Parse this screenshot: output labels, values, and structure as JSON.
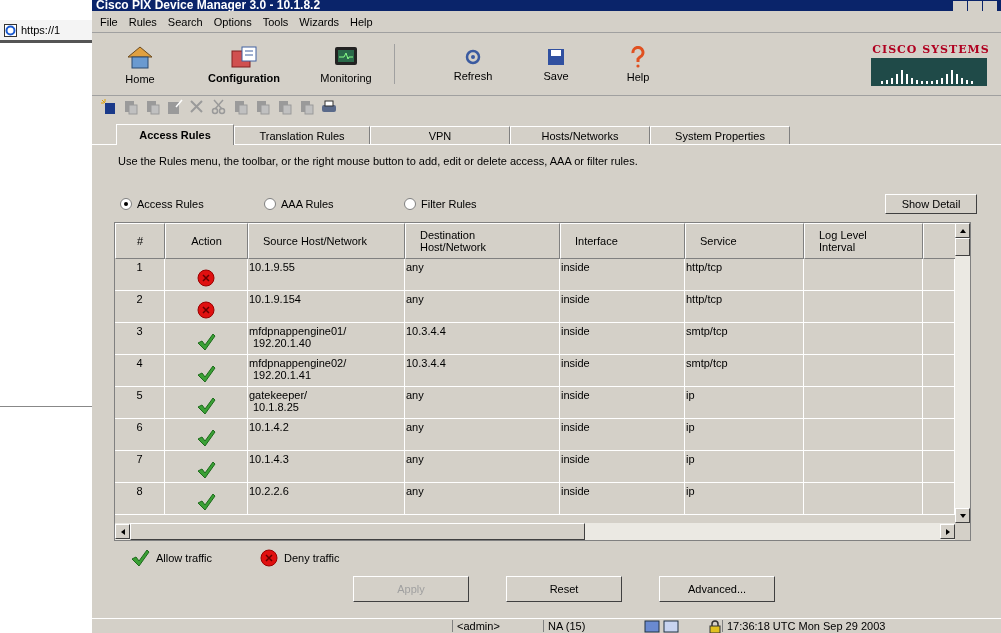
{
  "browser": {
    "address": "https://1"
  },
  "window": {
    "title": "Cisco PIX Device Manager 3.0 - 10.1.8.2"
  },
  "menu": [
    "File",
    "Rules",
    "Search",
    "Options",
    "Tools",
    "Wizards",
    "Help"
  ],
  "toolbar": [
    {
      "label": "Home",
      "kind": "house",
      "selected": false
    },
    {
      "label": "Configuration",
      "kind": "firewall",
      "selected": true
    },
    {
      "label": "Monitoring",
      "kind": "monitor",
      "selected": false
    },
    {
      "label": "Refresh",
      "kind": "refresh",
      "selected": false
    },
    {
      "label": "Save",
      "kind": "disk",
      "selected": false
    },
    {
      "label": "Help",
      "kind": "question",
      "selected": false
    }
  ],
  "logo": {
    "text": "CISCO SYSTEMS"
  },
  "rule_toolbar": [
    {
      "kind": "new",
      "disabled": false
    },
    {
      "kind": "insert",
      "disabled": true
    },
    {
      "kind": "insert-after",
      "disabled": true
    },
    {
      "kind": "edit",
      "disabled": true
    },
    {
      "kind": "delete",
      "disabled": true
    },
    {
      "kind": "cut",
      "disabled": true
    },
    {
      "kind": "copy",
      "disabled": true
    },
    {
      "kind": "paste",
      "disabled": true
    },
    {
      "kind": "paste-after",
      "disabled": true
    },
    {
      "kind": "paste-before",
      "disabled": true
    },
    {
      "kind": "print",
      "disabled": false
    }
  ],
  "tabs": [
    {
      "label": "Access Rules",
      "selected": true
    },
    {
      "label": "Translation Rules",
      "selected": false
    },
    {
      "label": "VPN",
      "selected": false
    },
    {
      "label": "Hosts/Networks",
      "selected": false
    },
    {
      "label": "System Properties",
      "selected": false
    }
  ],
  "instructions": "Use the Rules menu, the toolbar, or the right mouse button to add, edit or delete access, AAA or filter rules.",
  "rule_types": [
    {
      "label": "Access Rules",
      "selected": true
    },
    {
      "label": "AAA Rules",
      "selected": false
    },
    {
      "label": "Filter Rules",
      "selected": false
    }
  ],
  "show_detail": "Show Detail",
  "table": {
    "columns": [
      "#",
      "Action",
      "Source Host/Network",
      "Destination Host/Network",
      "Interface",
      "Service",
      "Log Level Interval"
    ],
    "rows": [
      {
        "number": "1",
        "kind": "deny",
        "source": [
          "10.1.9.55"
        ],
        "destination": "any",
        "interface": "inside",
        "service": "http/tcp"
      },
      {
        "number": "2",
        "kind": "deny",
        "source": [
          "10.1.9.154"
        ],
        "destination": "any",
        "interface": "inside",
        "service": "http/tcp"
      },
      {
        "number": "3",
        "kind": "allow",
        "source": [
          "mfdpnappengine01/",
          "192.20.1.40"
        ],
        "destination": "10.3.4.4",
        "interface": "inside",
        "service": "smtp/tcp"
      },
      {
        "number": "4",
        "kind": "allow",
        "source": [
          "mfdpnappengine02/",
          "192.20.1.41"
        ],
        "destination": "10.3.4.4",
        "interface": "inside",
        "service": "smtp/tcp"
      },
      {
        "number": "5",
        "kind": "allow",
        "source": [
          "gatekeeper/",
          "10.1.8.25"
        ],
        "destination": "any",
        "interface": "inside",
        "service": "ip"
      },
      {
        "number": "6",
        "kind": "allow",
        "source": [
          "10.1.4.2"
        ],
        "destination": "any",
        "interface": "inside",
        "service": "ip"
      },
      {
        "number": "7",
        "kind": "allow",
        "source": [
          "10.1.4.3"
        ],
        "destination": "any",
        "interface": "inside",
        "service": "ip"
      },
      {
        "number": "8",
        "kind": "allow",
        "source": [
          "10.2.2.6"
        ],
        "destination": "any",
        "interface": "inside",
        "service": "ip"
      }
    ]
  },
  "legend": [
    {
      "kind": "allow",
      "label": "Allow traffic"
    },
    {
      "kind": "deny",
      "label": "Deny traffic"
    }
  ],
  "buttons": [
    {
      "label": "Apply",
      "disabled": true
    },
    {
      "label": "Reset",
      "disabled": false
    },
    {
      "label": "Advanced...",
      "disabled": false
    }
  ],
  "status_bar": {
    "user": "<admin>",
    "privilege": "NA (15)",
    "time": "17:36:18 UTC Mon Sep 29 2003"
  }
}
